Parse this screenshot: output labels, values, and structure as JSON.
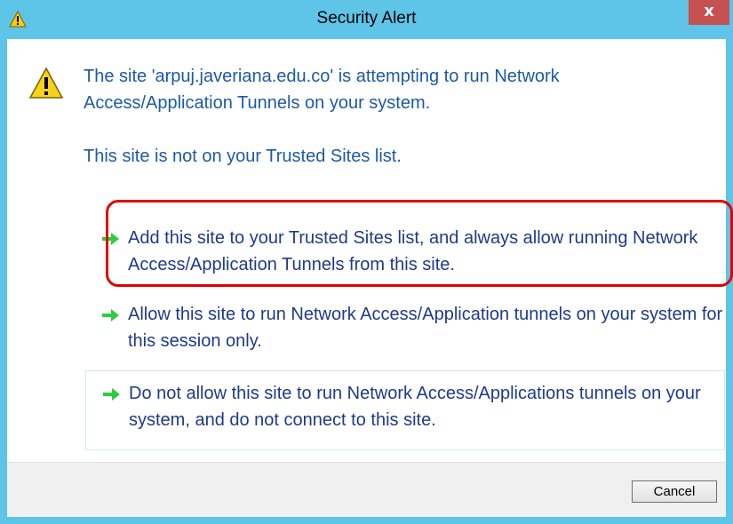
{
  "window": {
    "title": "Security Alert",
    "close_label": "x",
    "accent_color": "#5ec4e8"
  },
  "message": {
    "line1": "The site 'arpuj.javeriana.edu.co' is attempting to run Network Access/Application Tunnels on your system.",
    "line2": "This site is not on your Trusted Sites list."
  },
  "options": [
    {
      "label": "Add this site to your Trusted Sites list, and always allow running Network Access/Application Tunnels from this site.",
      "icon": "green-arrow-icon"
    },
    {
      "label": "Allow this site to run Network Access/Application tunnels on your system for this session only.",
      "icon": "green-arrow-icon"
    },
    {
      "label": "Do not allow this site to run Network Access/Applications tunnels on your system, and do not connect to this site.",
      "icon": "green-arrow-icon"
    }
  ],
  "footer": {
    "cancel_label": "Cancel"
  },
  "colors": {
    "highlight": "#e30000",
    "arrow": "#2ecc40",
    "text": "#1c5aa6"
  }
}
